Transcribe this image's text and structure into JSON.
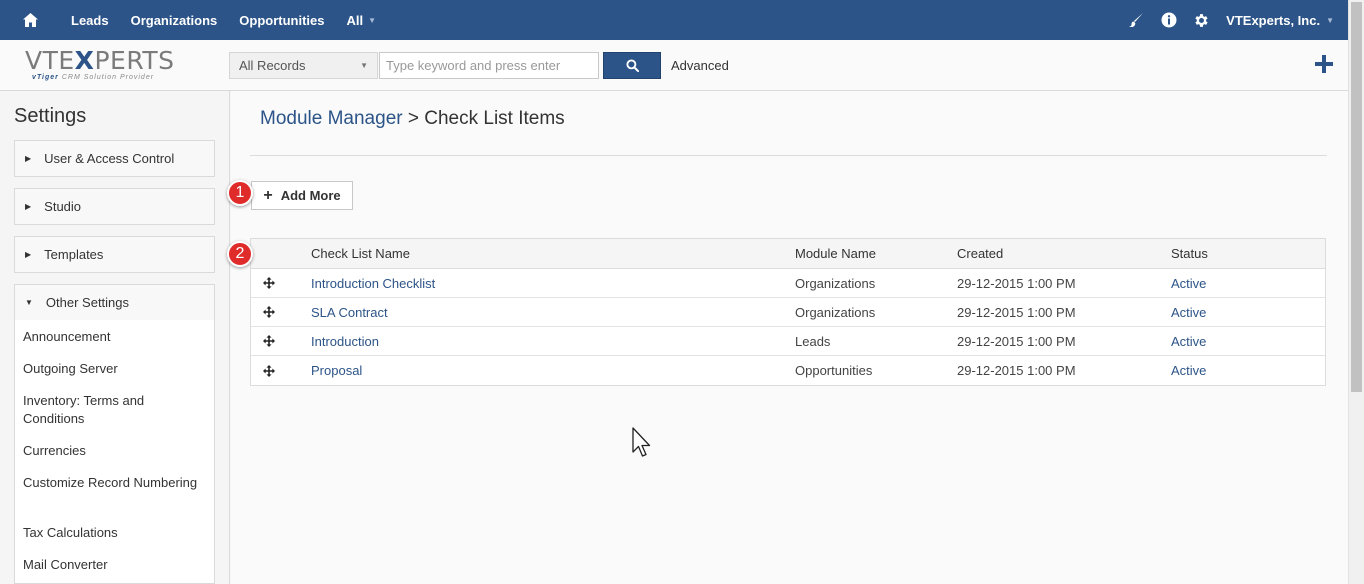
{
  "nav": {
    "items": [
      "Leads",
      "Organizations",
      "Opportunities",
      "All"
    ],
    "company": "VTExperts, Inc."
  },
  "header": {
    "logo_main_left": "VTE",
    "logo_main_x": "X",
    "logo_main_right": "PERTS",
    "logo_tag_brand": "vTiger",
    "logo_tag_rest": "CRM Solution Provider",
    "record_filter": "All Records",
    "search_placeholder": "Type keyword and press enter",
    "advanced_label": "Advanced"
  },
  "sidebar": {
    "title": "Settings",
    "sections": [
      "User & Access Control",
      "Studio",
      "Templates",
      "Other Settings"
    ],
    "other_settings_items": [
      "Announcement",
      "Outgoing Server",
      "Inventory: Terms and Conditions",
      "Currencies",
      "Customize Record Numbering",
      "Tax Calculations",
      "Mail Converter"
    ]
  },
  "content": {
    "breadcrumb_link": "Module Manager",
    "breadcrumb_sep": " > ",
    "breadcrumb_current": "Check List Items",
    "add_button_label": "Add More",
    "badges": [
      "1",
      "2"
    ],
    "table": {
      "headers": [
        "Check List Name",
        "Module Name",
        "Created",
        "Status"
      ],
      "rows": [
        {
          "name": "Introduction Checklist",
          "module": "Organizations",
          "created": "29-12-2015 1:00 PM",
          "status": "Active"
        },
        {
          "name": "SLA Contract",
          "module": "Organizations",
          "created": "29-12-2015 1:00 PM",
          "status": "Active"
        },
        {
          "name": "Introduction",
          "module": "Leads",
          "created": "29-12-2015 1:00 PM",
          "status": "Active"
        },
        {
          "name": "Proposal",
          "module": "Opportunities",
          "created": "29-12-2015 1:00 PM",
          "status": "Active"
        }
      ]
    }
  },
  "colors": {
    "brand_blue": "#2c5488",
    "badge_red": "#e02b2b"
  }
}
